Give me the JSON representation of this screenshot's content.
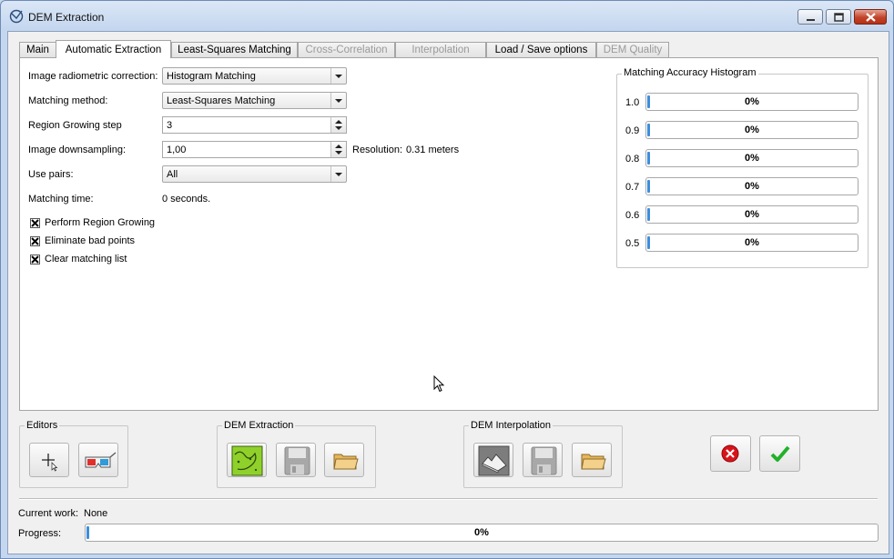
{
  "window": {
    "title": "DEM Extraction",
    "icon": "app-logo-icon"
  },
  "tabs": [
    {
      "label": "Main",
      "state": "normal"
    },
    {
      "label": "Automatic Extraction",
      "state": "active"
    },
    {
      "label": "Least-Squares Matching",
      "state": "normal"
    },
    {
      "label": "Cross-Correlation",
      "state": "disabled"
    },
    {
      "label": "Interpolation",
      "state": "disabled"
    },
    {
      "label": "Load / Save options",
      "state": "normal"
    },
    {
      "label": "DEM Quality",
      "state": "disabled"
    }
  ],
  "form": {
    "radiometric_label": "Image radiometric correction:",
    "radiometric_value": "Histogram Matching",
    "method_label": "Matching method:",
    "method_value": "Least-Squares Matching",
    "region_step_label": "Region Growing step",
    "region_step_value": "3",
    "downsampling_label": "Image downsampling:",
    "downsampling_value": "1,00",
    "resolution_label": "Resolution:",
    "resolution_value": "0.31 meters",
    "pairs_label": "Use pairs:",
    "pairs_value": "All",
    "time_label": "Matching time:",
    "time_value": "0 seconds.",
    "checks": [
      {
        "label": "Perform Region Growing",
        "checked": true
      },
      {
        "label": "Eliminate bad points",
        "checked": true
      },
      {
        "label": "Clear matching list",
        "checked": true
      }
    ]
  },
  "histogram": {
    "title": "Matching Accuracy Histogram",
    "rows": [
      {
        "label": "1.0",
        "percent_text": "0%",
        "value": 0
      },
      {
        "label": "0.9",
        "percent_text": "0%",
        "value": 0
      },
      {
        "label": "0.8",
        "percent_text": "0%",
        "value": 0
      },
      {
        "label": "0.7",
        "percent_text": "0%",
        "value": 0
      },
      {
        "label": "0.6",
        "percent_text": "0%",
        "value": 0
      },
      {
        "label": "0.5",
        "percent_text": "0%",
        "value": 0
      }
    ]
  },
  "groups": {
    "editors": "Editors",
    "extraction": "DEM Extraction",
    "interpolation": "DEM Interpolation"
  },
  "status": {
    "current_work_label": "Current work:",
    "current_work_value": "None",
    "progress_label": "Progress:",
    "progress_text": "0%",
    "progress_value": 0
  },
  "colors": {
    "accent": "#3b8ede",
    "cancel": "#d8141b",
    "ok": "#22b12a"
  }
}
